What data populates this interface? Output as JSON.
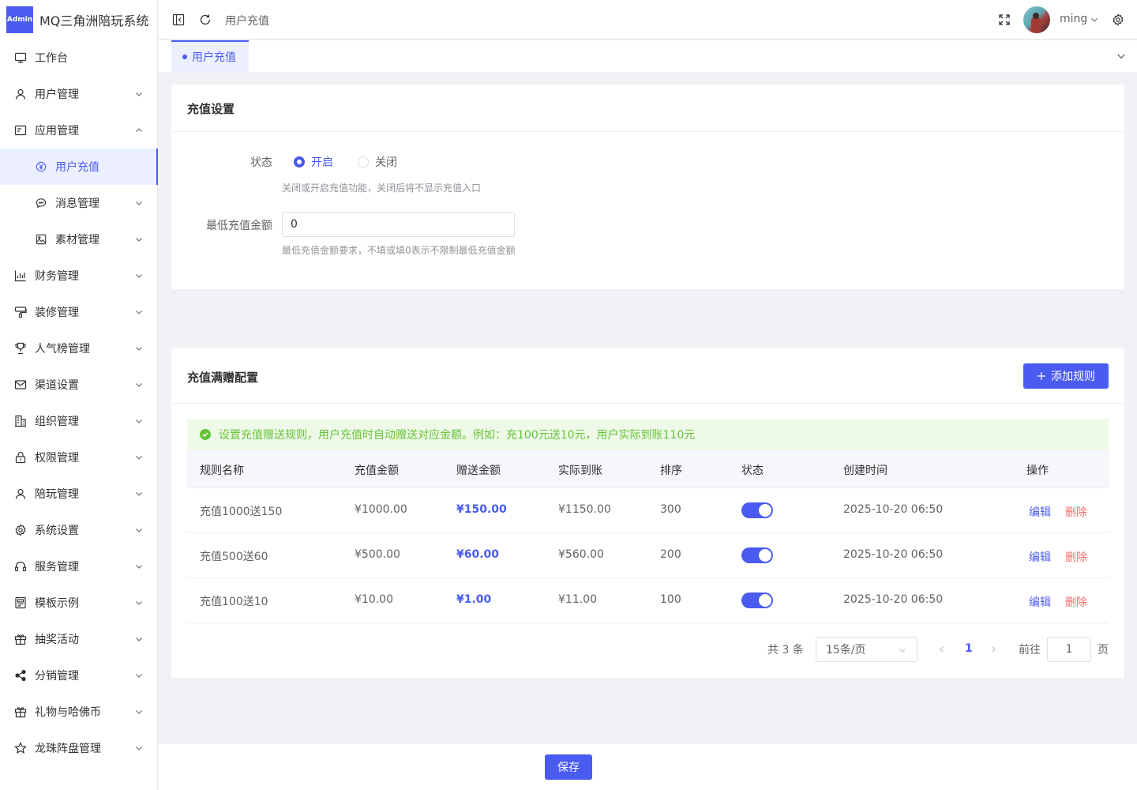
{
  "app": {
    "logo_badge": "Admin",
    "title": "MQ三角洲陪玩系统"
  },
  "sidebar": {
    "items": [
      {
        "label": "工作台",
        "icon": "monitor-icon"
      },
      {
        "label": "用户管理",
        "icon": "user-icon"
      },
      {
        "label": "应用管理",
        "icon": "app-icon"
      },
      {
        "label": "用户充值",
        "icon": "yen-circle-icon"
      },
      {
        "label": "消息管理",
        "icon": "chat-icon"
      },
      {
        "label": "素材管理",
        "icon": "image-icon"
      },
      {
        "label": "财务管理",
        "icon": "chart-icon"
      },
      {
        "label": "装修管理",
        "icon": "brush-icon"
      },
      {
        "label": "人气榜管理",
        "icon": "trophy-icon"
      },
      {
        "label": "渠道设置",
        "icon": "mail-icon"
      },
      {
        "label": "组织管理",
        "icon": "building-icon"
      },
      {
        "label": "权限管理",
        "icon": "lock-icon"
      },
      {
        "label": "陪玩管理",
        "icon": "user-icon"
      },
      {
        "label": "系统设置",
        "icon": "gear-icon"
      },
      {
        "label": "服务管理",
        "icon": "headset-icon"
      },
      {
        "label": "模板示例",
        "icon": "template-icon"
      },
      {
        "label": "抽奖活动",
        "icon": "gift-icon"
      },
      {
        "label": "分销管理",
        "icon": "share-icon"
      },
      {
        "label": "礼物与哈佛币",
        "icon": "gift-icon"
      },
      {
        "label": "龙珠阵盘管理",
        "icon": "star-icon"
      }
    ]
  },
  "header": {
    "breadcrumb": "用户充值",
    "username": "ming"
  },
  "tabs": [
    {
      "label": "用户充值"
    }
  ],
  "settings": {
    "title": "充值设置",
    "status_label": "状态",
    "status_on": "开启",
    "status_off": "关闭",
    "status_value": "开启",
    "status_hint": "关闭或开启充值功能，关闭后将不显示充值入口",
    "min_label": "最低充值金额",
    "min_value": "0",
    "min_hint": "最低充值金额要求，不填或填0表示不限制最低充值金额"
  },
  "rules": {
    "title": "充值满赠配置",
    "add_button": "添加规则",
    "alert": "设置充值赠送规则，用户充值时自动赠送对应金额。例如：充100元送10元，用户实际到账110元",
    "columns": [
      "规则名称",
      "充值金额",
      "赠送金额",
      "实际到账",
      "排序",
      "状态",
      "创建时间",
      "操作"
    ],
    "rows": [
      {
        "name": "充值1000送150",
        "amount": "¥1000.00",
        "bonus": "¥150.00",
        "total": "¥1150.00",
        "sort": "300",
        "enabled": true,
        "created": "2025-10-20 06:50",
        "edit": "编辑",
        "delete": "删除"
      },
      {
        "name": "充值500送60",
        "amount": "¥500.00",
        "bonus": "¥60.00",
        "total": "¥560.00",
        "sort": "200",
        "enabled": true,
        "created": "2025-10-20 06:50",
        "edit": "编辑",
        "delete": "删除"
      },
      {
        "name": "充值100送10",
        "amount": "¥10.00",
        "bonus": "¥1.00",
        "total": "¥11.00",
        "sort": "100",
        "enabled": true,
        "created": "2025-10-20 06:50",
        "edit": "编辑",
        "delete": "删除"
      }
    ],
    "pagination": {
      "total": "共 3 条",
      "page_size": "15条/页",
      "current_page": "1",
      "goto_label": "前往",
      "goto_value": "1",
      "page_suffix": "页"
    }
  },
  "footer": {
    "save_button": "保存"
  },
  "colors": {
    "primary": "#4a5bf0",
    "success": "#67c23a",
    "danger": "#f56c6c"
  }
}
